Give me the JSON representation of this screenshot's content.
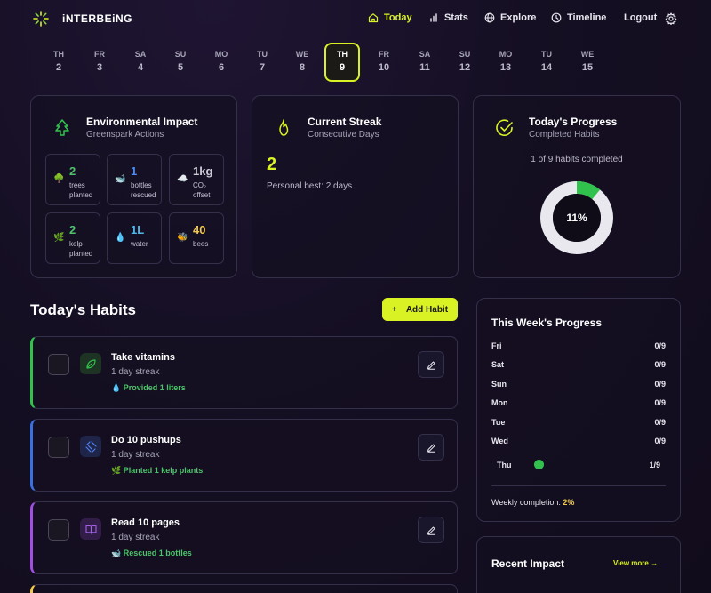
{
  "header": {
    "brand": "iNTERBEiNG",
    "nav": {
      "today": "Today",
      "stats": "Stats",
      "explore": "Explore",
      "timeline": "Timeline",
      "logout": "Logout"
    },
    "accent_color": "#d9f224"
  },
  "days": [
    {
      "dow": "TH",
      "num": "2"
    },
    {
      "dow": "FR",
      "num": "3"
    },
    {
      "dow": "SA",
      "num": "4"
    },
    {
      "dow": "SU",
      "num": "5"
    },
    {
      "dow": "MO",
      "num": "6"
    },
    {
      "dow": "TU",
      "num": "7"
    },
    {
      "dow": "WE",
      "num": "8"
    },
    {
      "dow": "TH",
      "num": "9",
      "selected": true
    },
    {
      "dow": "FR",
      "num": "10"
    },
    {
      "dow": "SA",
      "num": "11"
    },
    {
      "dow": "SU",
      "num": "12"
    },
    {
      "dow": "MO",
      "num": "13"
    },
    {
      "dow": "TU",
      "num": "14"
    },
    {
      "dow": "WE",
      "num": "15"
    }
  ],
  "environmental": {
    "title": "Environmental Impact",
    "subtitle": "Greenspark Actions",
    "tiles": [
      {
        "icon": "tree-icon",
        "value": "2",
        "label1": "trees",
        "label2": "planted",
        "color": "#4cc46a"
      },
      {
        "icon": "bottle-icon",
        "value": "1",
        "label1": "bottles",
        "label2": "rescued",
        "color": "#4f8cf0"
      },
      {
        "icon": "cloud-icon",
        "value": "1kg",
        "label1": "CO₂",
        "label2": "offset",
        "color": "#cfcbd9"
      },
      {
        "icon": "kelp-icon",
        "value": "2",
        "label1": "kelp",
        "label2": "planted",
        "color": "#4cc46a"
      },
      {
        "icon": "water-drop-icon",
        "value": "1L",
        "label1": "water",
        "label2": "",
        "color": "#4fb8e8"
      },
      {
        "icon": "bee-icon",
        "value": "40",
        "label1": "bees",
        "label2": "",
        "color": "#f2c94c"
      }
    ]
  },
  "streak": {
    "title": "Current Streak",
    "subtitle": "Consecutive Days",
    "value": "2",
    "best": "Personal best: 2 days"
  },
  "progress": {
    "title": "Today's Progress",
    "subtitle": "Completed Habits",
    "text": "1 of 9 habits completed",
    "percent_label": "11%",
    "fraction": 0.11
  },
  "habits": {
    "title": "Today's Habits",
    "add_label": "Add Habit",
    "items": [
      {
        "name": "Take vitamins",
        "streak": "1 day streak",
        "impact": "💧 Provided 1 liters",
        "accent": "#31c24d",
        "icon": "leaf-icon"
      },
      {
        "name": "Do 10 pushups",
        "streak": "1 day streak",
        "impact": "🌿 Planted 1 kelp plants",
        "accent": "#3b6fe0",
        "icon": "dumbbell-icon"
      },
      {
        "name": "Read 10 pages",
        "streak": "1 day streak",
        "impact": "🐋 Rescued 1 bottles",
        "accent": "#a04fe0",
        "icon": "book-icon"
      }
    ]
  },
  "week": {
    "title": "This Week's Progress",
    "rows": [
      {
        "day": "Fri",
        "value": "0/9"
      },
      {
        "day": "Sat",
        "value": "0/9"
      },
      {
        "day": "Sun",
        "value": "0/9"
      },
      {
        "day": "Mon",
        "value": "0/9"
      },
      {
        "day": "Tue",
        "value": "0/9"
      },
      {
        "day": "Wed",
        "value": "0/9"
      },
      {
        "day": "Thu",
        "value": "1/9",
        "current": true
      }
    ],
    "completion_label": "Weekly completion:",
    "completion_value": "2%"
  },
  "recent": {
    "title": "Recent Impact",
    "view_more": "View more →"
  }
}
